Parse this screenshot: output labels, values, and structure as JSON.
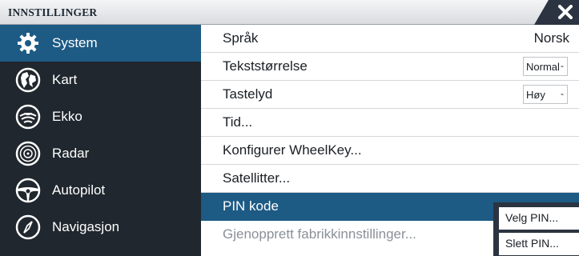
{
  "window": {
    "title": "INNSTILLINGER",
    "close_icon": "close-icon"
  },
  "sidebar": {
    "items": [
      {
        "label": "System",
        "icon": "gear-icon",
        "selected": true
      },
      {
        "label": "Kart",
        "icon": "chart-globe-icon"
      },
      {
        "label": "Ekko",
        "icon": "echo-sounder-icon"
      },
      {
        "label": "Radar",
        "icon": "radar-icon"
      },
      {
        "label": "Autopilot",
        "icon": "steering-wheel-icon"
      },
      {
        "label": "Navigasjon",
        "icon": "navigation-compass-icon"
      }
    ]
  },
  "settings": {
    "rows": [
      {
        "label": "Språk",
        "value": "Norsk"
      },
      {
        "label": "Tekststørrelse",
        "select": "Normal"
      },
      {
        "label": "Tastelyd",
        "select": "Høy"
      },
      {
        "label": "Tid..."
      },
      {
        "label": "Konfigurer WheelKey..."
      },
      {
        "label": "Satellitter..."
      },
      {
        "label": "PIN kode",
        "highlighted": true
      },
      {
        "label": "Gjenopprett fabrikkinnstillinger..."
      }
    ]
  },
  "pin_menu": {
    "items": [
      {
        "label": "Velg PIN..."
      },
      {
        "label": "Slett PIN..."
      }
    ]
  },
  "colors": {
    "accent": "#1d5a84",
    "sidebar_bg": "#20272e",
    "titlebar_bg": "#e6e8ea"
  }
}
